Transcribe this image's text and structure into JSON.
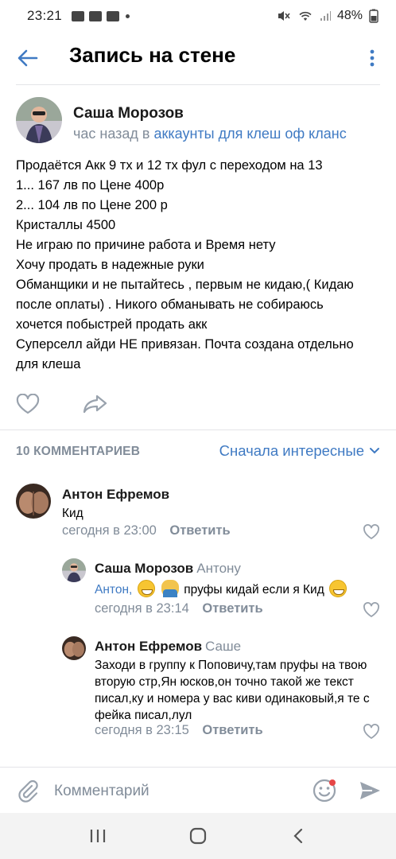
{
  "status_bar": {
    "time": "23:21",
    "battery": "48%"
  },
  "header": {
    "title": "Запись на стене"
  },
  "post": {
    "author": "Саша Морозов",
    "time_prefix": "час назад в",
    "group": "аккаунты для клеш оф кланс",
    "lines": [
      "Продаётся   Акк 9 тх и 12 тх фул с переходом на 13",
      "1... 167 лв по Цене 400р",
      "2... 104 лв по Цене 200 р",
      "Кристаллы 4500",
      "Не играю по причине работа и Время нету",
      "Хочу продать в надежные руки",
      "Обманщики и не пытайтесь , первым не кидаю,( Кидаю",
      "после оплаты) . Никого обманывать не собираюсь",
      "хочется побыстрей продать акк",
      "Суперселл айди НЕ привязан. Почта создана отдельно",
      "для клеша"
    ]
  },
  "comments_header": {
    "count_label": "10 КОММЕНТАРИЕВ",
    "sort_label": "Сначала интересные"
  },
  "comments": [
    {
      "author": "Антон Ефремов",
      "text": "Кид",
      "time": "сегодня в 23:00",
      "reply_label": "Ответить"
    },
    {
      "author": "Саша Морозов",
      "reply_to": "Антону",
      "mention": "Антон,",
      "text": "пруфы кидай если я Кид",
      "time": "сегодня в 23:14",
      "reply_label": "Ответить"
    },
    {
      "author": "Антон Ефремов",
      "reply_to": "Саше",
      "lines": [
        "Заходи в группу к Поповичу,там пруфы на твою",
        "вторую стр,Ян юсков,он точно такой же текст",
        "писал,ку и номера у вас киви одинаковый,я те с",
        "фейка писал,лул"
      ],
      "time": "сегодня в 23:15",
      "reply_label": "Ответить"
    }
  ],
  "input": {
    "placeholder": "Комментарий"
  },
  "colors": {
    "accent": "#3f7ac3",
    "secondary_text": "#818c99",
    "divider": "#e3e4e8"
  }
}
